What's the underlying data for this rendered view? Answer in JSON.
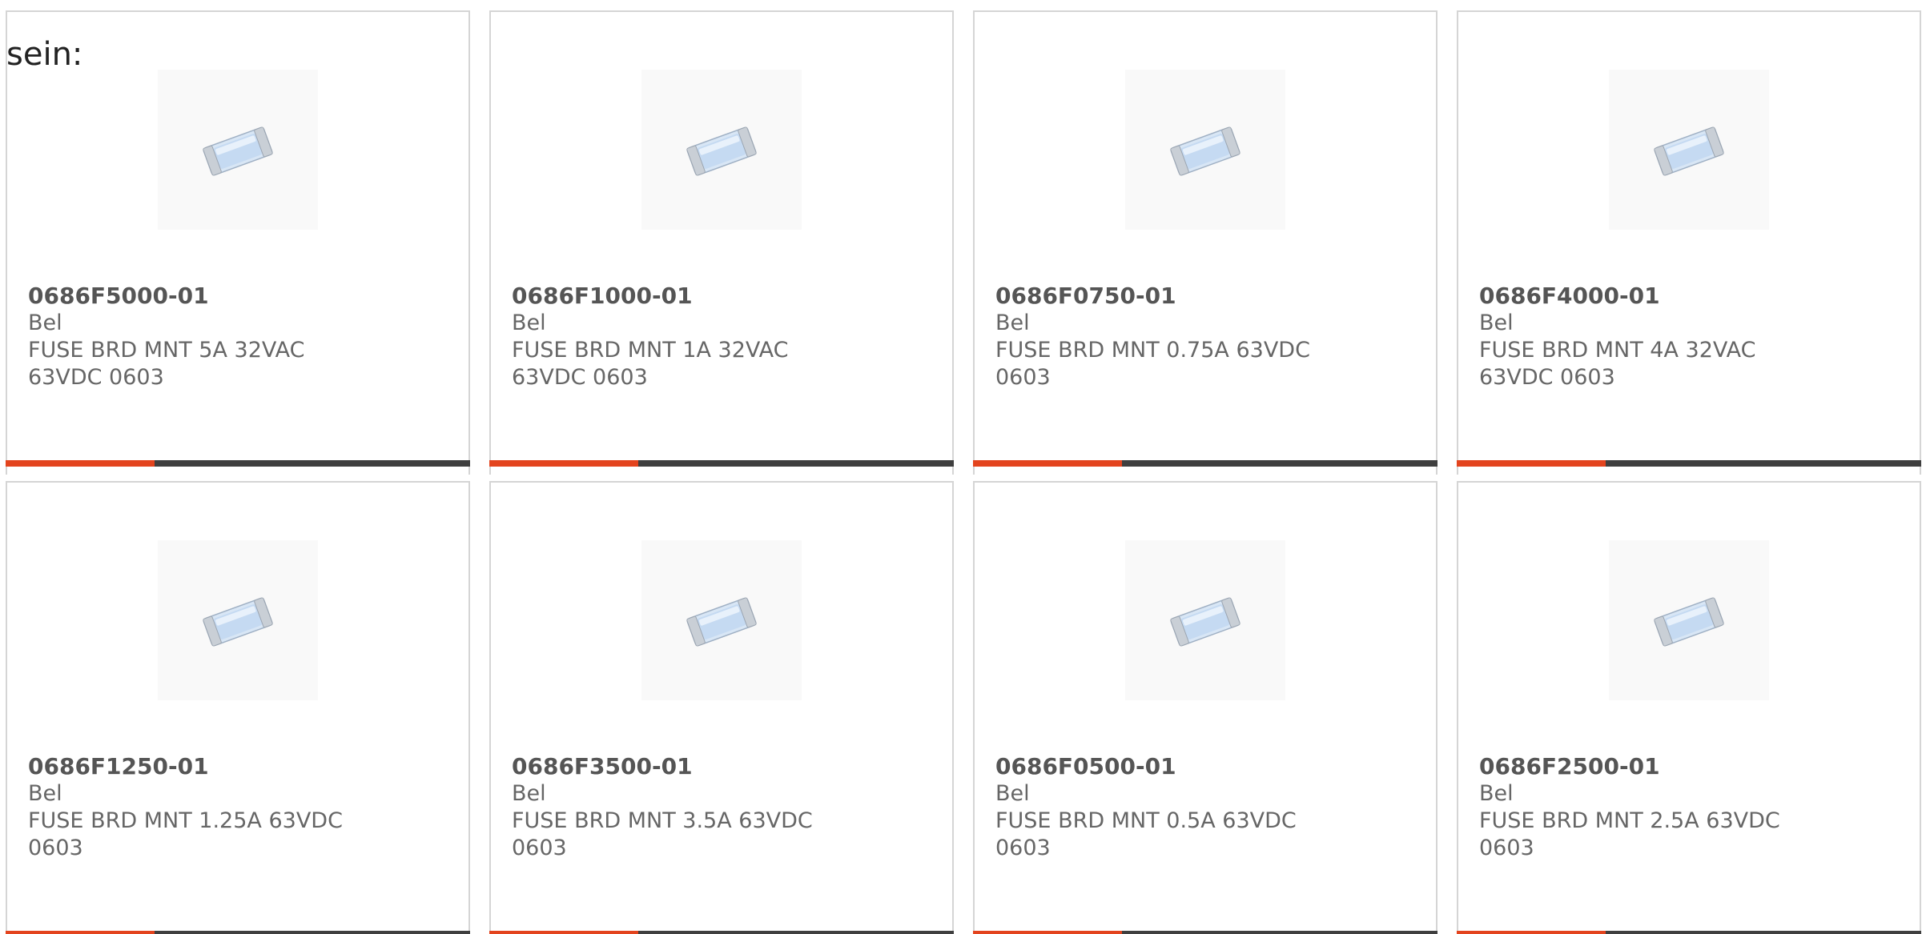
{
  "intro_text": "sein:",
  "accent_color": "#e3441e",
  "track_color": "#3f3f3f",
  "image_icon": "smd-fuse-chip-icon",
  "products": [
    {
      "part_number": "0686F5000-01",
      "manufacturer": "Bel",
      "description": "FUSE BRD MNT 5A 32VAC 63VDC 0603",
      "progress": 0.32
    },
    {
      "part_number": "0686F1000-01",
      "manufacturer": "Bel",
      "description": "FUSE BRD MNT 1A 32VAC 63VDC 0603",
      "progress": 0.32
    },
    {
      "part_number": "0686F0750-01",
      "manufacturer": "Bel",
      "description": "FUSE BRD MNT 0.75A 63VDC 0603",
      "progress": 0.32
    },
    {
      "part_number": "0686F4000-01",
      "manufacturer": "Bel",
      "description": "FUSE BRD MNT 4A 32VAC 63VDC 0603",
      "progress": 0.32
    },
    {
      "part_number": "0686F1250-01",
      "manufacturer": "Bel",
      "description": "FUSE BRD MNT 1.25A 63VDC 0603",
      "progress": 0.32
    },
    {
      "part_number": "0686F3500-01",
      "manufacturer": "Bel",
      "description": "FUSE BRD MNT 3.5A 63VDC 0603",
      "progress": 0.32
    },
    {
      "part_number": "0686F0500-01",
      "manufacturer": "Bel",
      "description": "FUSE BRD MNT 0.5A 63VDC 0603",
      "progress": 0.32
    },
    {
      "part_number": "0686F2500-01",
      "manufacturer": "Bel",
      "description": "FUSE BRD MNT 2.5A 63VDC 0603",
      "progress": 0.32
    }
  ]
}
